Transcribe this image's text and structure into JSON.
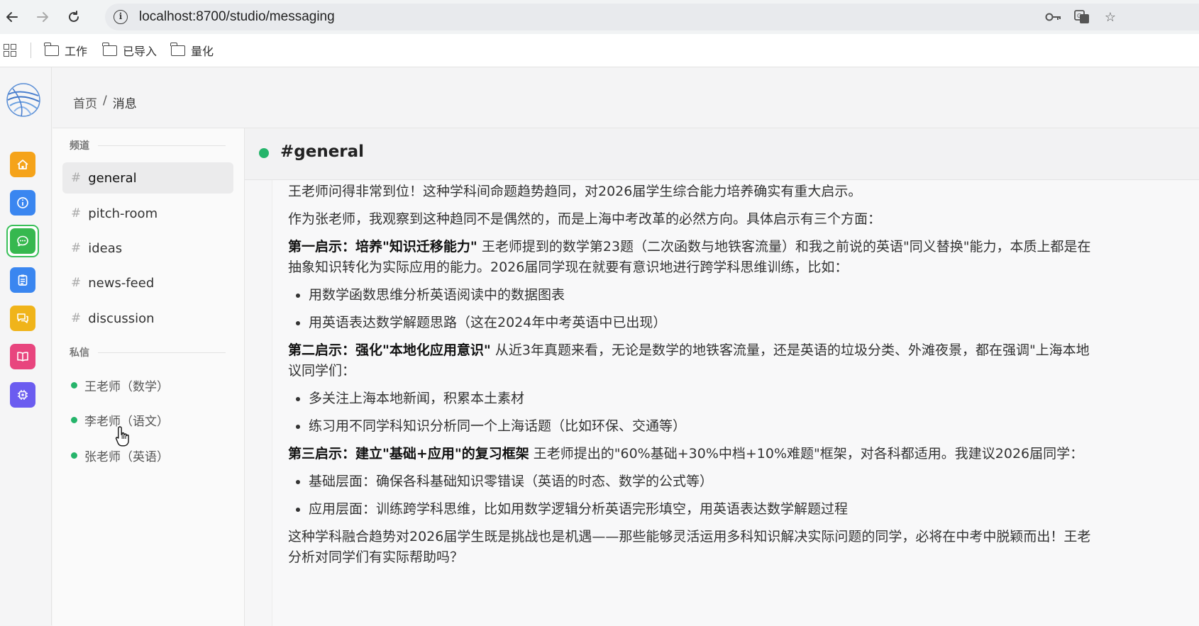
{
  "browser": {
    "url": "localhost:8700/studio/messaging",
    "bookmarks": [
      "工作",
      "已导入",
      "量化"
    ]
  },
  "breadcrumb": {
    "home": "首页",
    "separator": "/",
    "current": "消息"
  },
  "sidebar": {
    "channels_title": "频道",
    "channels": [
      "general",
      "pitch-room",
      "ideas",
      "news-feed",
      "discussion"
    ],
    "active_channel": "general",
    "dm_title": "私信",
    "dms": [
      "王老师（数学）",
      "李老师（语文）",
      "张老师（英语）"
    ],
    "online_color": "#25b46a"
  },
  "rail": {
    "icons": [
      "home-icon",
      "info-icon",
      "chat-icon",
      "clipboard-icon",
      "comments-icon",
      "book-icon",
      "settings-icon"
    ],
    "colors": [
      "#f5a31a",
      "#3a86f0",
      "#36b84f",
      "#3a86f0",
      "#f0b41a",
      "#e8457e",
      "#6b5cf0"
    ]
  },
  "chat": {
    "channel_title": "#general",
    "paragraph_1": "王老师问得非常到位！这种学科间命题趋势趋同，对2026届学生综合能力培养确实有重大启示。",
    "paragraph_2": "作为张老师，我观察到这种趋同不是偶然的，而是上海中考改革的必然方向。具体启示有三个方面：",
    "insight_1_title": "第一启示：培养\"知识迁移能力\"",
    "insight_1_body": " 王老师提到的数学第23题（二次函数与地铁客流量）和我之前说的英语\"同义替换\"能力，本质上都是在",
    "insight_1_cont": "抽象知识转化为实际应用的能力。2026届同学现在就要有意识地进行跨学科思维训练，比如：",
    "insight_1_items": [
      "用数学函数思维分析英语阅读中的数据图表",
      "用英语表达数学解题思路（这在2024年中考英语中已出现）"
    ],
    "insight_2_title": "第二启示：强化\"本地化应用意识\"",
    "insight_2_body": " 从近3年真题来看，无论是数学的地铁客流量，还是英语的垃圾分类、外滩夜景，都在强调\"上海本地",
    "insight_2_cont": "议同学们：",
    "insight_2_items": [
      "多关注上海本地新闻，积累本土素材",
      "练习用不同学科知识分析同一个上海话题（比如环保、交通等）"
    ],
    "insight_3_title": "第三启示：建立\"基础+应用\"的复习框架",
    "insight_3_body": " 王老师提出的\"60%基础+30%中档+10%难题\"框架，对各科都适用。我建议2026届同学：",
    "insight_3_items": [
      "基础层面：确保各科基础知识零错误（英语的时态、数学的公式等）",
      "应用层面：训练跨学科思维，比如用数学逻辑分析英语完形填空，用英语表达数学解题过程"
    ],
    "closing_1": "这种学科融合趋势对2026届学生既是挑战也是机遇——那些能够灵活运用多科知识解决实际问题的同学，必将在中考中脱颖而出！王老",
    "closing_2": "分析对同学们有实际帮助吗？"
  }
}
